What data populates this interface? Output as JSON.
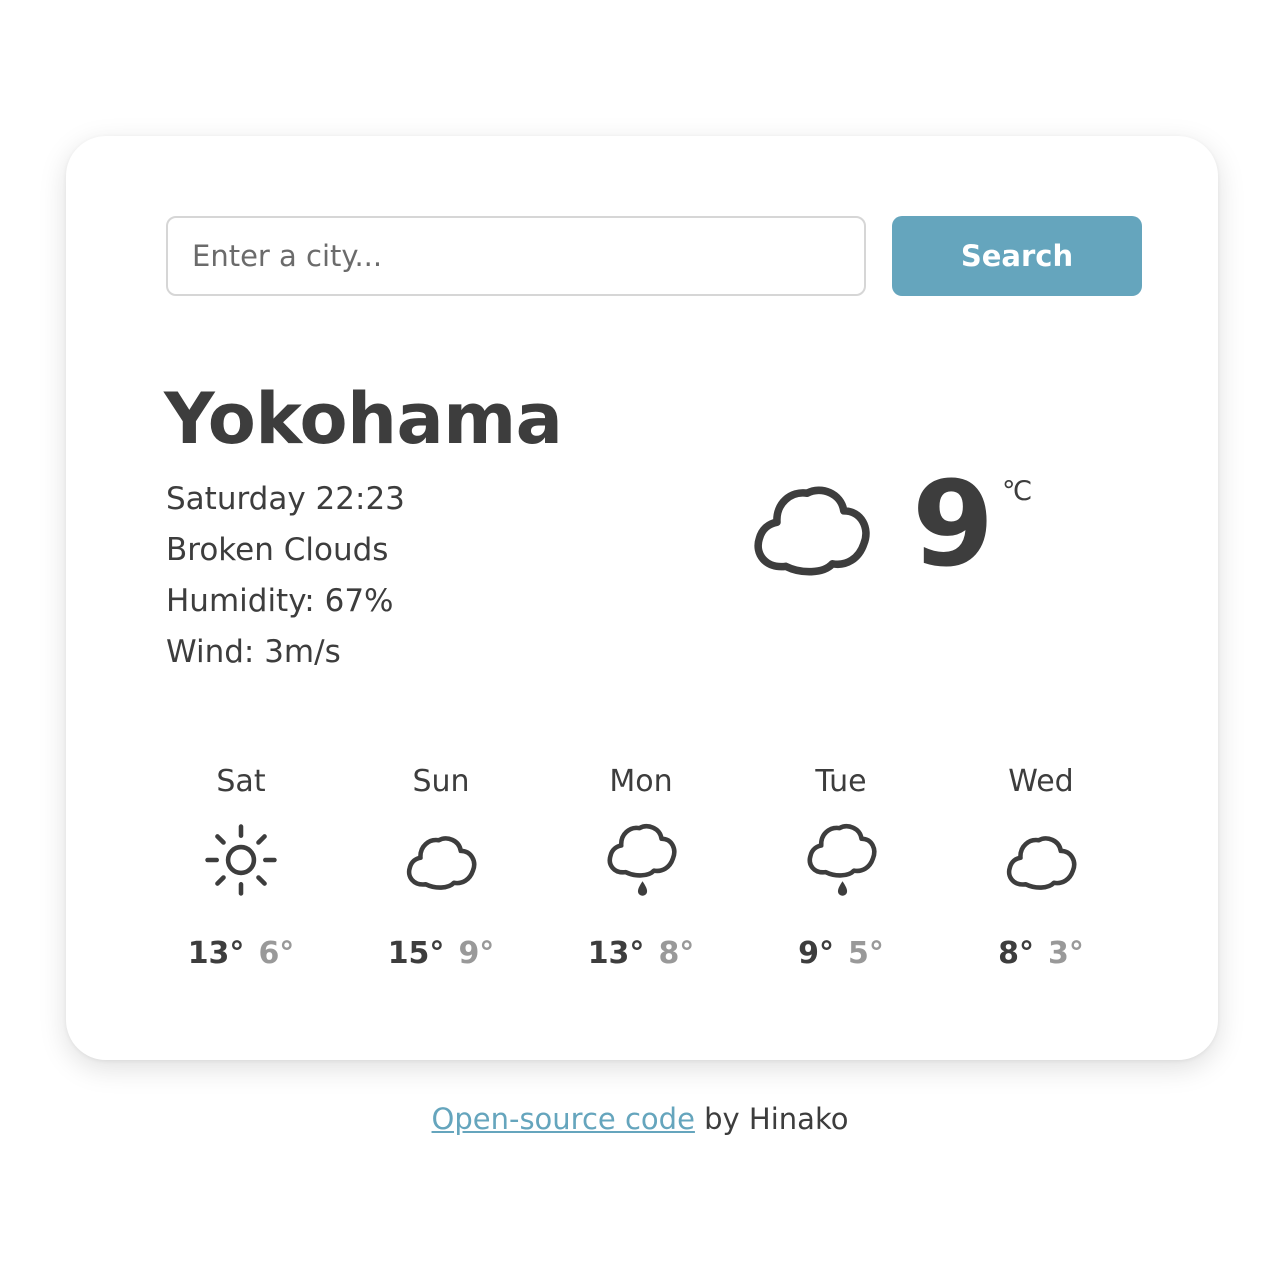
{
  "search": {
    "placeholder": "Enter a city...",
    "button_label": "Search"
  },
  "current": {
    "city": "Yokohama",
    "date_time": "Saturday 22:23",
    "description": "Broken Clouds",
    "humidity": "Humidity: 67%",
    "wind": "Wind: 3m/s",
    "icon": "cloud-icon",
    "temperature": "9",
    "unit": "℃"
  },
  "forecast": [
    {
      "day": "Sat",
      "icon": "sun-icon",
      "high": "13°",
      "low": "6°"
    },
    {
      "day": "Sun",
      "icon": "cloud-icon",
      "high": "15°",
      "low": "9°"
    },
    {
      "day": "Mon",
      "icon": "rain-cloud-icon",
      "high": "13°",
      "low": "8°"
    },
    {
      "day": "Tue",
      "icon": "rain-cloud-icon",
      "high": "9°",
      "low": "5°"
    },
    {
      "day": "Wed",
      "icon": "cloud-icon",
      "high": "8°",
      "low": "3°"
    }
  ],
  "footer": {
    "link_text": "Open-source code",
    "author_text": " by Hinako"
  },
  "colors": {
    "accent": "#65a5bd",
    "text": "#3d3d3d",
    "muted": "#999999"
  }
}
